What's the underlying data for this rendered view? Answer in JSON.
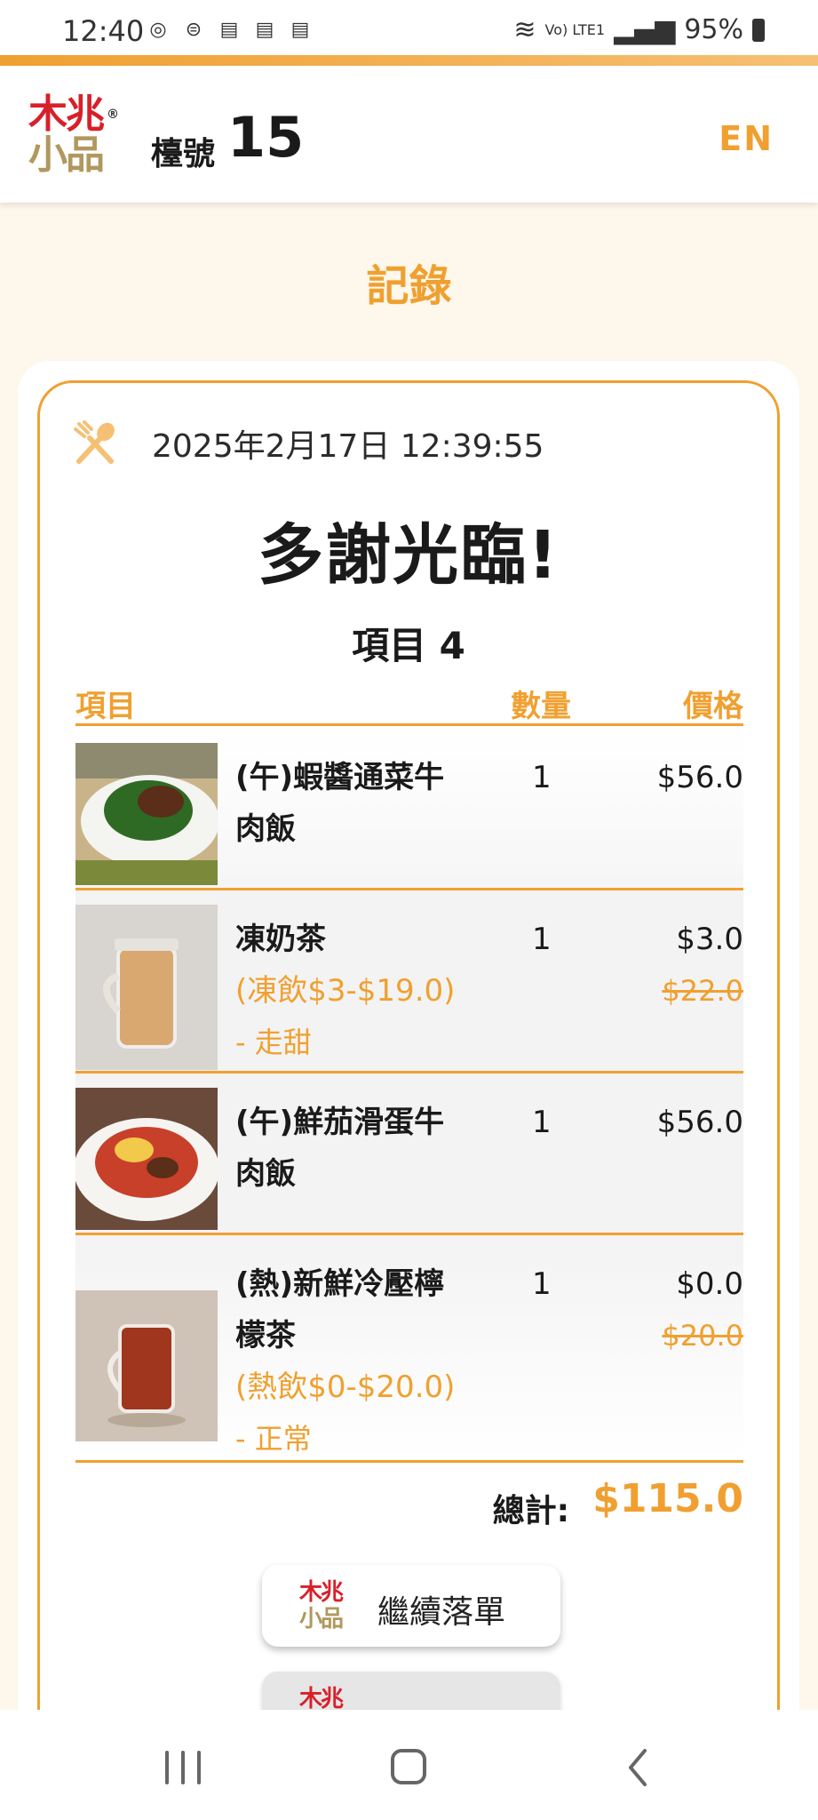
{
  "status_bar": {
    "time": "12:40",
    "network": "Vo) LTE1",
    "battery": "95%"
  },
  "header": {
    "logo_line1": "木兆",
    "logo_line2": "小品",
    "logo_mark": "®",
    "table_label": "檯號",
    "table_number": "15",
    "lang_button": "EN"
  },
  "page_title": "記錄",
  "receipt": {
    "timestamp": "2025年2月17日 12:39:55",
    "thanks": "多謝光臨!",
    "item_count": "項目 4",
    "headers": {
      "item": "項目",
      "qty": "數量",
      "price": "價格"
    },
    "items": [
      {
        "name_line1": "(午)蝦醬通菜牛",
        "name_line2": "肉飯",
        "qty": "1",
        "price": "$56.0"
      },
      {
        "name_line1": "凍奶茶",
        "sub": "(凍飲$3-$19.0)",
        "option": "- 走甜",
        "qty": "1",
        "price": "$3.0",
        "original_price": "$22.0"
      },
      {
        "name_line1": "(午)鮮茄滑蛋牛",
        "name_line2": "肉飯",
        "qty": "1",
        "price": "$56.0"
      },
      {
        "name_line1": "(熱)新鮮冷壓檸",
        "name_line2": "檬茶",
        "sub": "(熱飲$0-$20.0)",
        "option": "- 正常",
        "qty": "1",
        "price": "$0.0",
        "original_price": "$20.0"
      }
    ],
    "total_label": "總計:",
    "total_value": "$115.0"
  },
  "continue_button": {
    "label": "繼續落單"
  },
  "icons": {
    "fork_spoon": "fork-spoon-icon",
    "nav_recent": "recent-apps-icon",
    "nav_home": "home-icon",
    "nav_back": "back-icon"
  },
  "colors": {
    "accent": "#f0a030",
    "brand_red": "#d8202a",
    "brand_gold": "#b0985e",
    "background": "#fdf7ec"
  }
}
